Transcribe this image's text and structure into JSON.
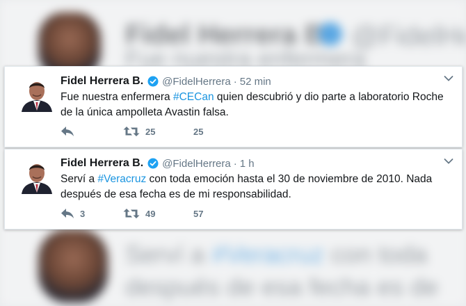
{
  "background": {
    "name": "Fidel Herrera B.",
    "handle": "@FidelHerrera",
    "line_a": "Fue nuestra enfermera",
    "line_b": "Serví a",
    "line_b_tag": "#Veracruz",
    "line_b_rest": "con toda",
    "line_c": "después de esa fecha es de"
  },
  "colors": {
    "hashtag": "#1b95e0",
    "verified": "#1da1f2",
    "muted": "#657786"
  },
  "tweets": [
    {
      "name": "Fidel Herrera B.",
      "handle": "@FidelHerrera",
      "separator": "·",
      "time": "52 min",
      "text_before": "Fue nuestra enfermera ",
      "hashtag": "#CECan",
      "text_after": " quien descubrió y dio parte a laboratorio Roche de la única ampolleta Avastin falsa.",
      "reply_count": "",
      "retweet_count": "25",
      "like_count": "25",
      "icons": [
        "reply-icon",
        "retweet-icon",
        "like-icon",
        "caret-down-icon",
        "verified-icon"
      ]
    },
    {
      "name": "Fidel Herrera B.",
      "handle": "@FidelHerrera",
      "separator": "·",
      "time": "1 h",
      "text_before": "Serví a ",
      "hashtag": "#Veracruz",
      "text_after": " con toda emoción hasta el 30 de noviembre de 2010. Nada después de esa fecha es de mi responsabilidad.",
      "reply_count": "3",
      "retweet_count": "49",
      "like_count": "57",
      "icons": [
        "reply-icon",
        "retweet-icon",
        "like-icon",
        "caret-down-icon",
        "verified-icon"
      ]
    }
  ]
}
